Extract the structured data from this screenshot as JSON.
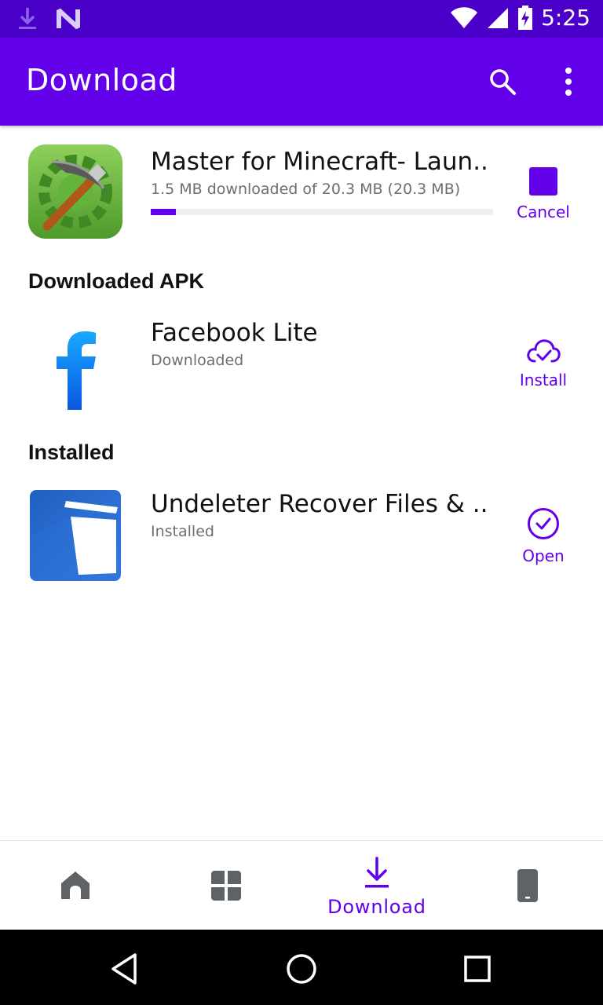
{
  "status_bar": {
    "time": "5:25",
    "icons": [
      "download-notification-icon",
      "n-notification-icon",
      "wifi-icon",
      "cell-signal-icon",
      "battery-charging-icon"
    ]
  },
  "app_bar": {
    "title": "Download",
    "icons": [
      "search-icon",
      "more-vert-icon"
    ]
  },
  "downloading": {
    "title": "Master for Minecraft- Laun...",
    "subtitle": "1.5 MB downloaded of 20.3 MB (20.3 MB)",
    "progress_fraction": 0.074,
    "action_label": "Cancel",
    "icon": "minecraft-pickaxe-icon"
  },
  "sections": {
    "downloaded_title": "Downloaded APK",
    "installed_title": "Installed"
  },
  "downloaded_item": {
    "title": "Facebook Lite",
    "subtitle": "Downloaded",
    "action_label": "Install",
    "icon": "facebook-lite-icon"
  },
  "installed_item": {
    "title": "Undeleter Recover Files & ...",
    "subtitle": "Installed",
    "action_label": "Open",
    "icon": "undeleter-trash-icon"
  },
  "bottom_nav": {
    "active_label": "Download",
    "items": [
      "home-icon",
      "apps-grid-icon",
      "download-icon",
      "phone-device-icon"
    ]
  },
  "colors": {
    "accent": "#6200ea",
    "status_bar": "#4a00c8",
    "inactive_icon": "#5f6368"
  }
}
